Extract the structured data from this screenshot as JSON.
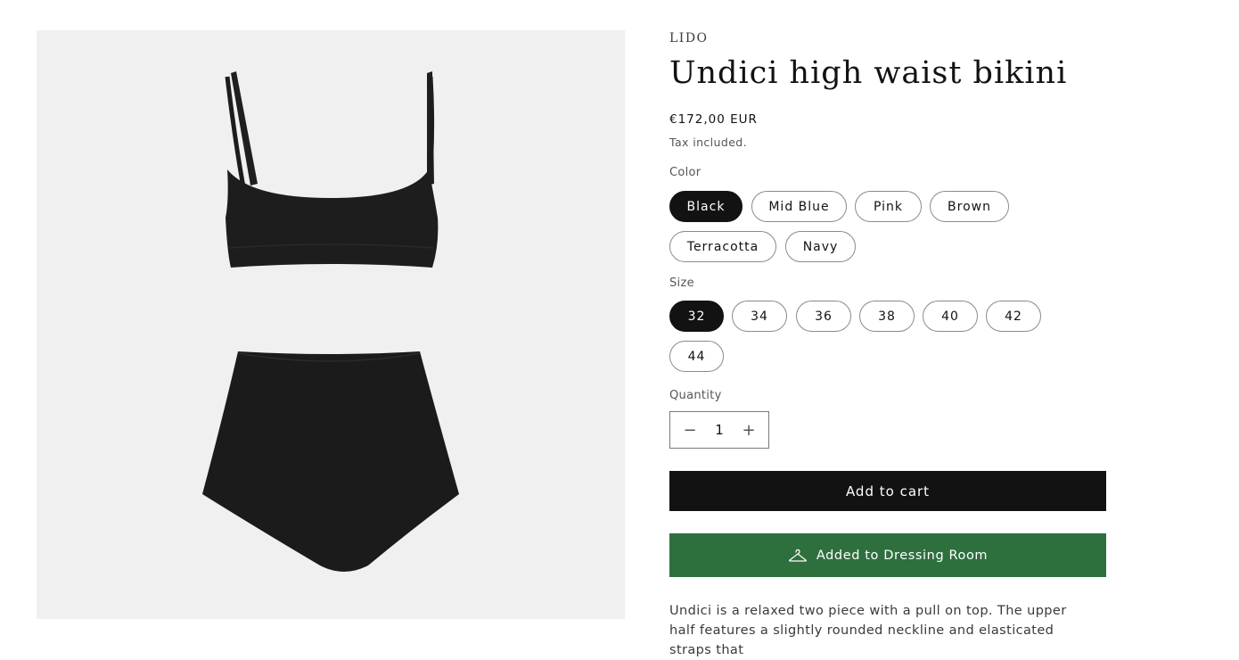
{
  "product": {
    "image_alt": "Black high waist bikini set",
    "vendor": "LIDO",
    "title": "Undici high waist bikini",
    "price": "€172,00 EUR",
    "tax_note": "Tax included."
  },
  "color": {
    "label": "Color",
    "options": [
      "Black",
      "Mid Blue",
      "Pink",
      "Brown",
      "Terracotta",
      "Navy"
    ],
    "selected": "Black"
  },
  "size": {
    "label": "Size",
    "options": [
      "32",
      "34",
      "36",
      "38",
      "40",
      "42",
      "44"
    ],
    "selected": "32"
  },
  "quantity": {
    "label": "Quantity",
    "value": "1",
    "decrease_symbol": "−",
    "increase_symbol": "+"
  },
  "actions": {
    "add_to_cart": "Add to cart",
    "dressing_room": "Added to Dressing Room",
    "dressing_icon": "hanger-icon"
  },
  "description": "Undici is a relaxed two piece with a pull on top. The upper half features a slightly rounded neckline and elasticated straps that"
}
